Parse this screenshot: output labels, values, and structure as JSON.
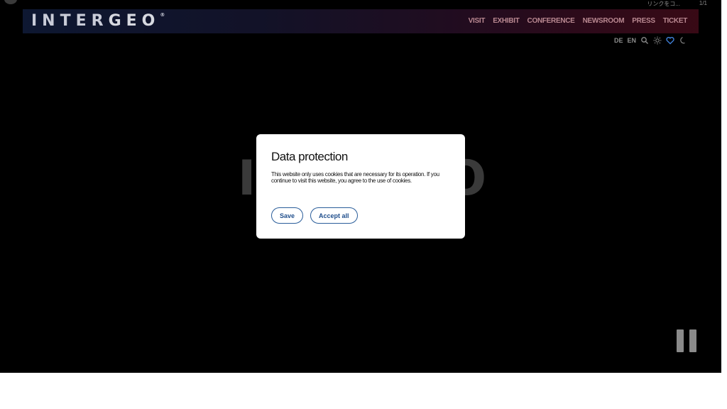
{
  "overlay": {
    "hint": "リンクをコ...",
    "count": "1/1"
  },
  "logo": {
    "part1": "INTER",
    "part2": "GEO",
    "mark": "®"
  },
  "nav": [
    {
      "label": "VISIT"
    },
    {
      "label": "EXHIBIT"
    },
    {
      "label": "CONFERENCE"
    },
    {
      "label": "NEWSROOM"
    },
    {
      "label": "PRESS"
    },
    {
      "label": "TICKET"
    }
  ],
  "tools": {
    "lang_de": "DE",
    "lang_en": "EN",
    "icons": [
      "search-icon",
      "sun-icon",
      "heart-icon",
      "moon-icon"
    ],
    "accent": "#3f7fd6"
  },
  "background": {
    "letter_left": "I",
    "letter_right": "O"
  },
  "modal": {
    "title": "Data protection",
    "text": "This website only uses cookies that are necessary for its operation. If you continue to visit this website, you agree to the use of cookies.",
    "save_label": "Save",
    "accept_label": "Accept all",
    "button_color": "#1f4e8c"
  }
}
